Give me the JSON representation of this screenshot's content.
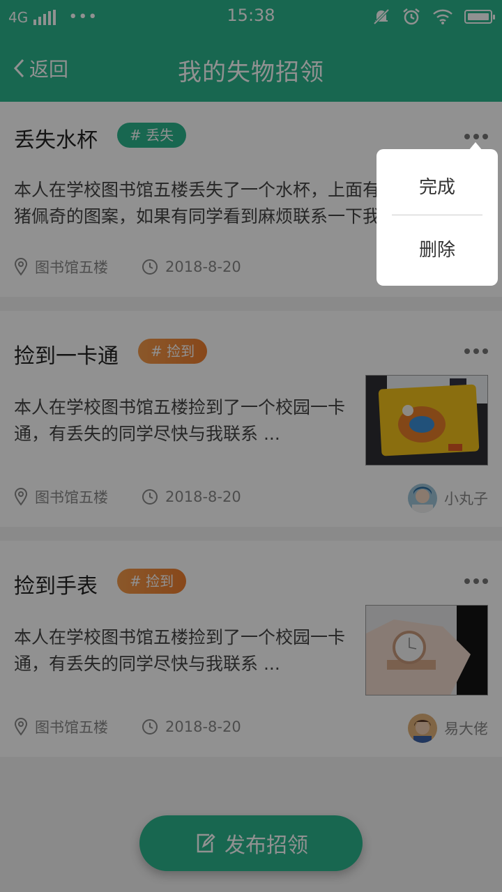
{
  "status": {
    "network": "4G",
    "dots": "•••",
    "time": "15:38"
  },
  "nav": {
    "back_label": "返回",
    "title": "我的失物招领"
  },
  "cards": [
    {
      "title": "丢失水杯",
      "tag": "# 丢失",
      "description": "本人在学校图书馆五楼丢失了一个水杯，上面有小猪佩奇的图案，如果有同学看到麻烦联系一下我",
      "location": "图书馆五楼",
      "date": "2018-8-20"
    },
    {
      "title": "捡到一卡通",
      "tag": "# 捡到",
      "description": "本人在学校图书馆五楼捡到了一个校园一卡通，有丢失的同学尽快与我联系 ...",
      "location": "图书馆五楼",
      "date": "2018-8-20",
      "user": "小丸子"
    },
    {
      "title": "捡到手表",
      "tag": "# 捡到",
      "description": "本人在学校图书馆五楼捡到了一个校园一卡通，有丢失的同学尽快与我联系 ...",
      "location": "图书馆五楼",
      "date": "2018-8-20",
      "user": "易大佬"
    }
  ],
  "menu": {
    "complete": "完成",
    "delete": "删除"
  },
  "fab": {
    "label": "发布招领"
  },
  "colors": {
    "accent": "#2bb58e",
    "tag_orange": "#ef7e2f"
  }
}
